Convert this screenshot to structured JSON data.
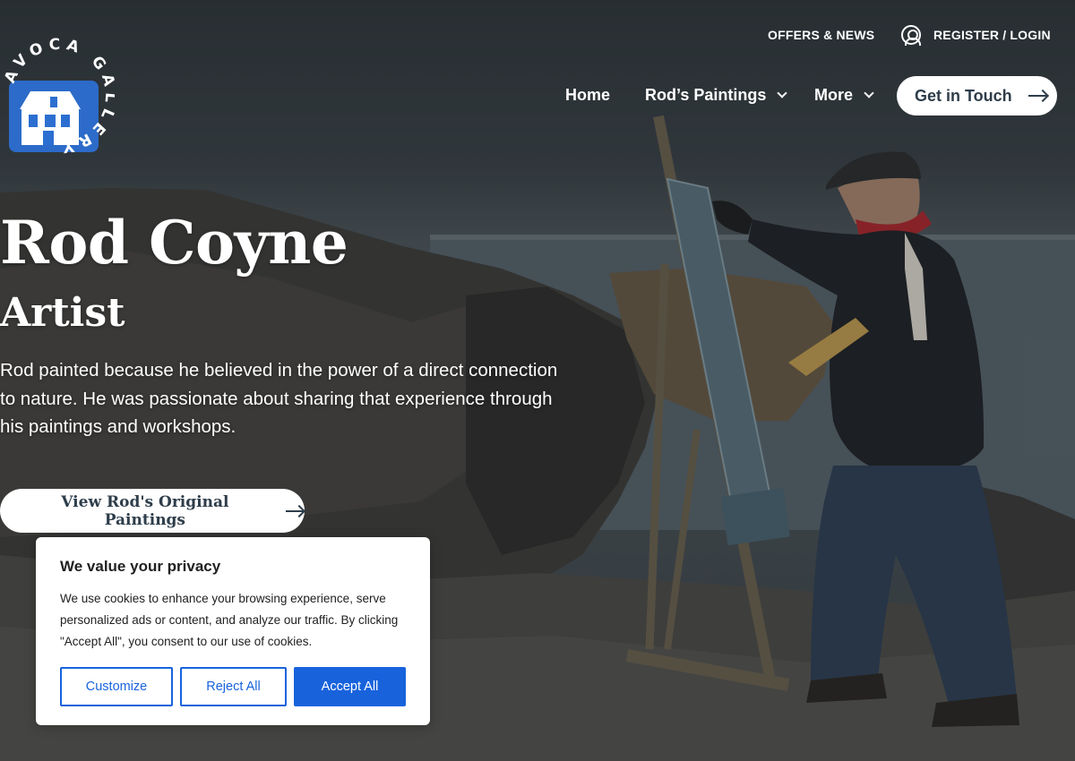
{
  "utility": {
    "offers_label": "OFFERS & NEWS",
    "register_label": "REGISTER / LOGIN"
  },
  "logo": {
    "ring_text": "AVOCA GALLERY"
  },
  "nav": {
    "home_label": "Home",
    "paintings_label": "Rod’s Paintings",
    "more_label": "More",
    "contact_label": "Get in Touch"
  },
  "hero": {
    "title": "Rod Coyne",
    "subtitle": "Artist",
    "description": "Rod painted because he believed in the power of a direct connection to nature. He was passionate about sharing that experience through his paintings and workshops.",
    "cta_label": "View Rod's Original Paintings"
  },
  "cookie": {
    "title": "We value your privacy",
    "text": "We use cookies to enhance your browsing experience, serve personalized ads or content, and analyze our traffic. By clicking \"Accept All\", you consent to our use of cookies.",
    "customize_label": "Customize",
    "reject_label": "Reject All",
    "accept_label": "Accept All"
  },
  "colors": {
    "button_text": "#2e3d4a",
    "cookie_accent": "#1863dc",
    "logo_blue": "#2c6fd1"
  },
  "icons": {
    "user": "user-circle-icon",
    "chevron": "chevron-down-icon",
    "arrow": "arrow-right-icon"
  }
}
